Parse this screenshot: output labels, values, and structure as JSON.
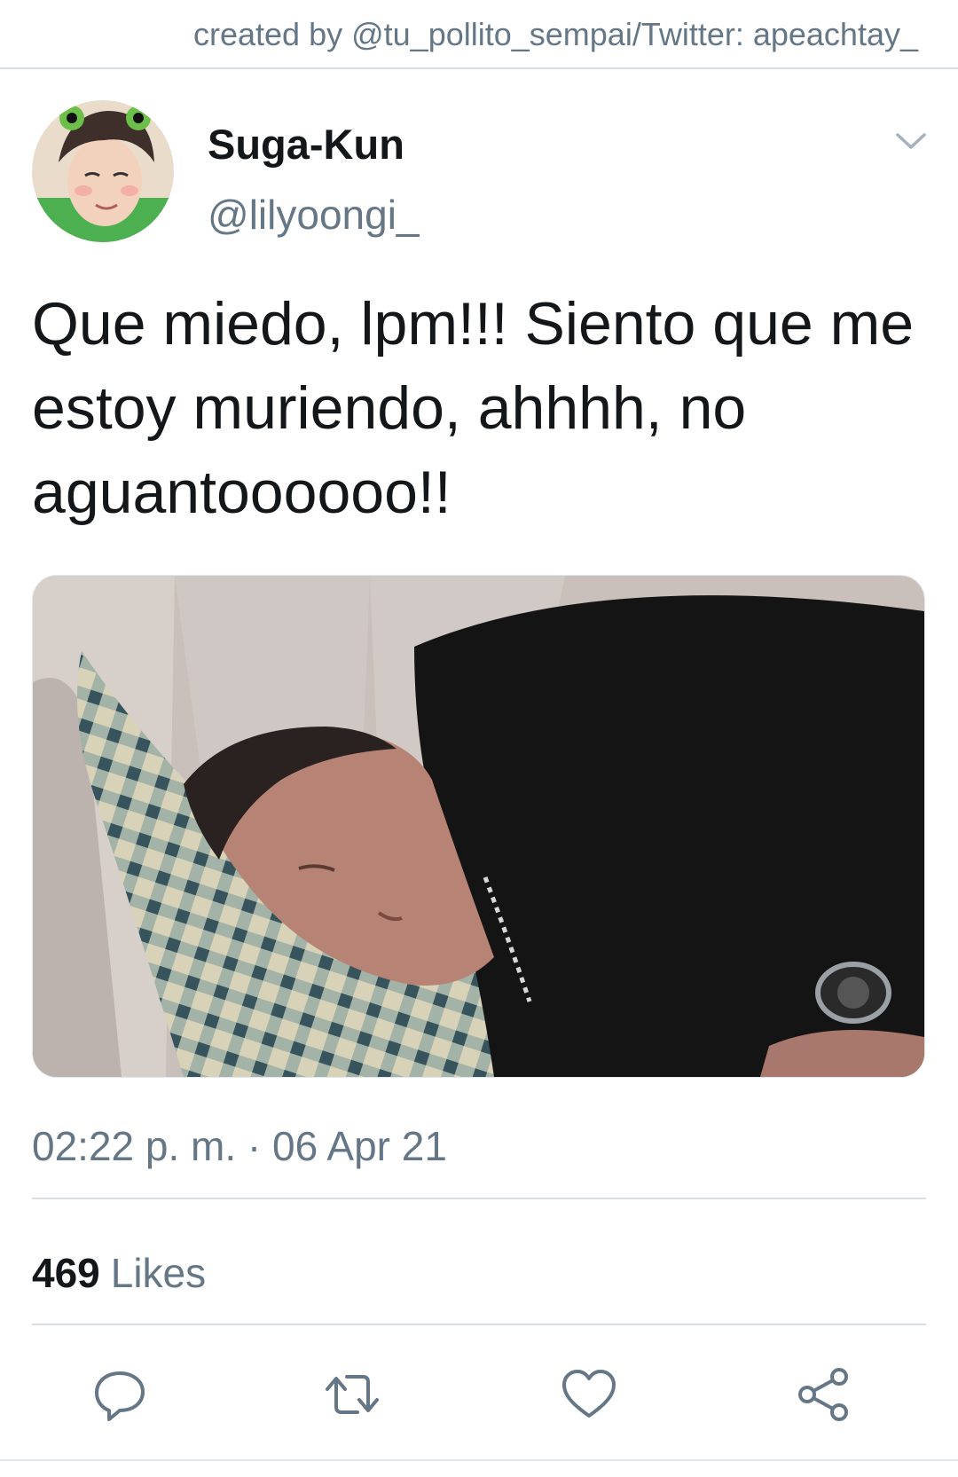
{
  "watermark": {
    "credit": "created by @tu_pollito_sempai/Twitter: apeachtay_"
  },
  "tweet": {
    "author": {
      "display_name": "Suga-Kun",
      "handle": "@lilyoongi_"
    },
    "text": "Que miedo, lpm!!! Siento que me estoy muriendo, ahhhh, no aguantoooooo!!",
    "timestamp": "02:22 p. m. · 06 Apr 21",
    "likes": {
      "count": "469",
      "label": "Likes"
    }
  },
  "icons": {
    "menu": "chevron-down-icon",
    "reply": "reply-icon",
    "retweet": "retweet-icon",
    "like": "heart-icon",
    "share": "share-icon"
  },
  "colors": {
    "text_primary": "#14171a",
    "text_secondary": "#657786",
    "divider": "#d9dee3"
  }
}
